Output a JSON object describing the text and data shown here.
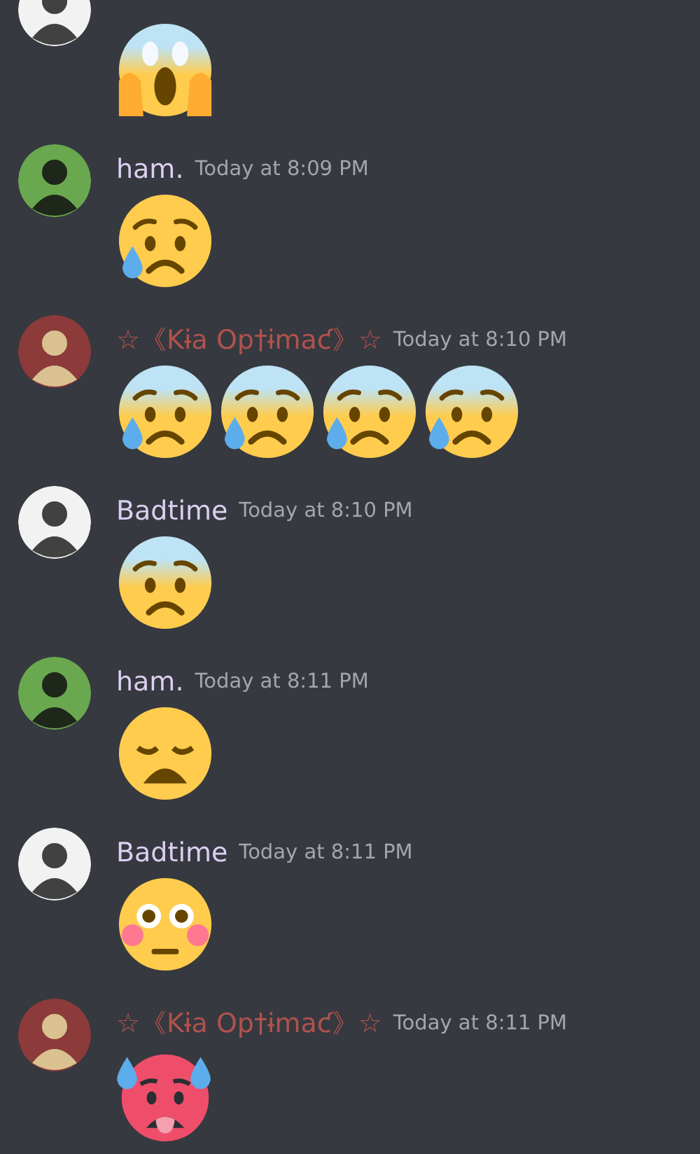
{
  "messages": [
    {
      "avatar": {
        "kind": "badtime"
      },
      "emojis": [
        {
          "kind": "screaming"
        }
      ]
    },
    {
      "avatar": {
        "kind": "ham"
      },
      "author": "ham.",
      "color": "#dccff2",
      "time": "Today at 8:09 PM",
      "emojis": [
        {
          "kind": "sad-sweat"
        }
      ]
    },
    {
      "avatar": {
        "kind": "kia"
      },
      "author": "☆《Kɨa Op†ɨmaƈ》☆",
      "color": "#b0524d",
      "time": "Today at 8:10 PM",
      "emojis": [
        {
          "kind": "anxious-sweat"
        },
        {
          "kind": "anxious-sweat"
        },
        {
          "kind": "anxious-sweat"
        },
        {
          "kind": "anxious-sweat"
        }
      ]
    },
    {
      "avatar": {
        "kind": "badtime"
      },
      "author": "Badtime",
      "color": "#dccff2",
      "time": "Today at 8:10 PM",
      "emojis": [
        {
          "kind": "fearful"
        }
      ]
    },
    {
      "avatar": {
        "kind": "ham"
      },
      "author": "ham.",
      "color": "#dccff2",
      "time": "Today at 8:11 PM",
      "emojis": [
        {
          "kind": "weary"
        }
      ]
    },
    {
      "avatar": {
        "kind": "badtime"
      },
      "author": "Badtime",
      "color": "#dccff2",
      "time": "Today at 8:11 PM",
      "emojis": [
        {
          "kind": "flushed"
        }
      ]
    },
    {
      "avatar": {
        "kind": "kia"
      },
      "author": "☆《Kɨa Op†ɨmaƈ》☆",
      "color": "#b0524d",
      "time": "Today at 8:11 PM",
      "emojis": [
        {
          "kind": "hot"
        }
      ]
    }
  ]
}
